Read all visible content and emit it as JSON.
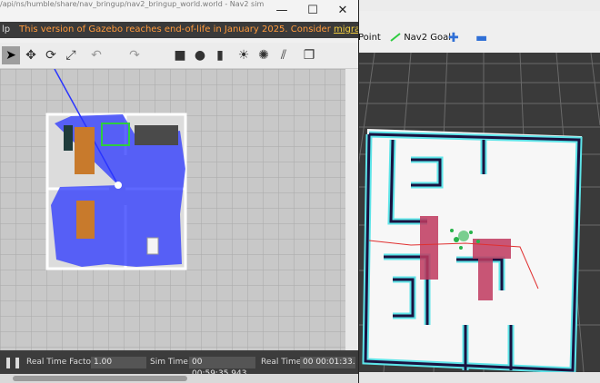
{
  "gazebo": {
    "window_path": "/api/ns/humble/share/nav_bringup/nav2_bringup_world.world - Nav2 sim",
    "banner": {
      "menu_fragment": "lp",
      "message": "This version of Gazebo reaches end-of-life in January 2025. Consider",
      "link_text": "migrating to the new Gazebo"
    },
    "toolbar_icons": [
      "select-arrow-icon",
      "translate-icon",
      "rotate-icon",
      "scale-icon",
      "undo-icon",
      "redo-icon",
      "box-icon",
      "sphere-icon",
      "cylinder-icon",
      "sun-icon",
      "spotlight-icon",
      "directional-light-icon",
      "copy-icon"
    ],
    "status": {
      "real_time_factor_label": "Real Time Factor:",
      "real_time_factor_value": "1.00",
      "sim_time_label": "Sim Time:",
      "sim_time_value": "00 00:59:35.943",
      "real_time_label": "Real Time:",
      "real_time_value": "00 00:01:33."
    }
  },
  "rviz": {
    "toolbar": {
      "point_label": "Point",
      "nav2_goal_label": "Nav2 Goal"
    }
  }
}
